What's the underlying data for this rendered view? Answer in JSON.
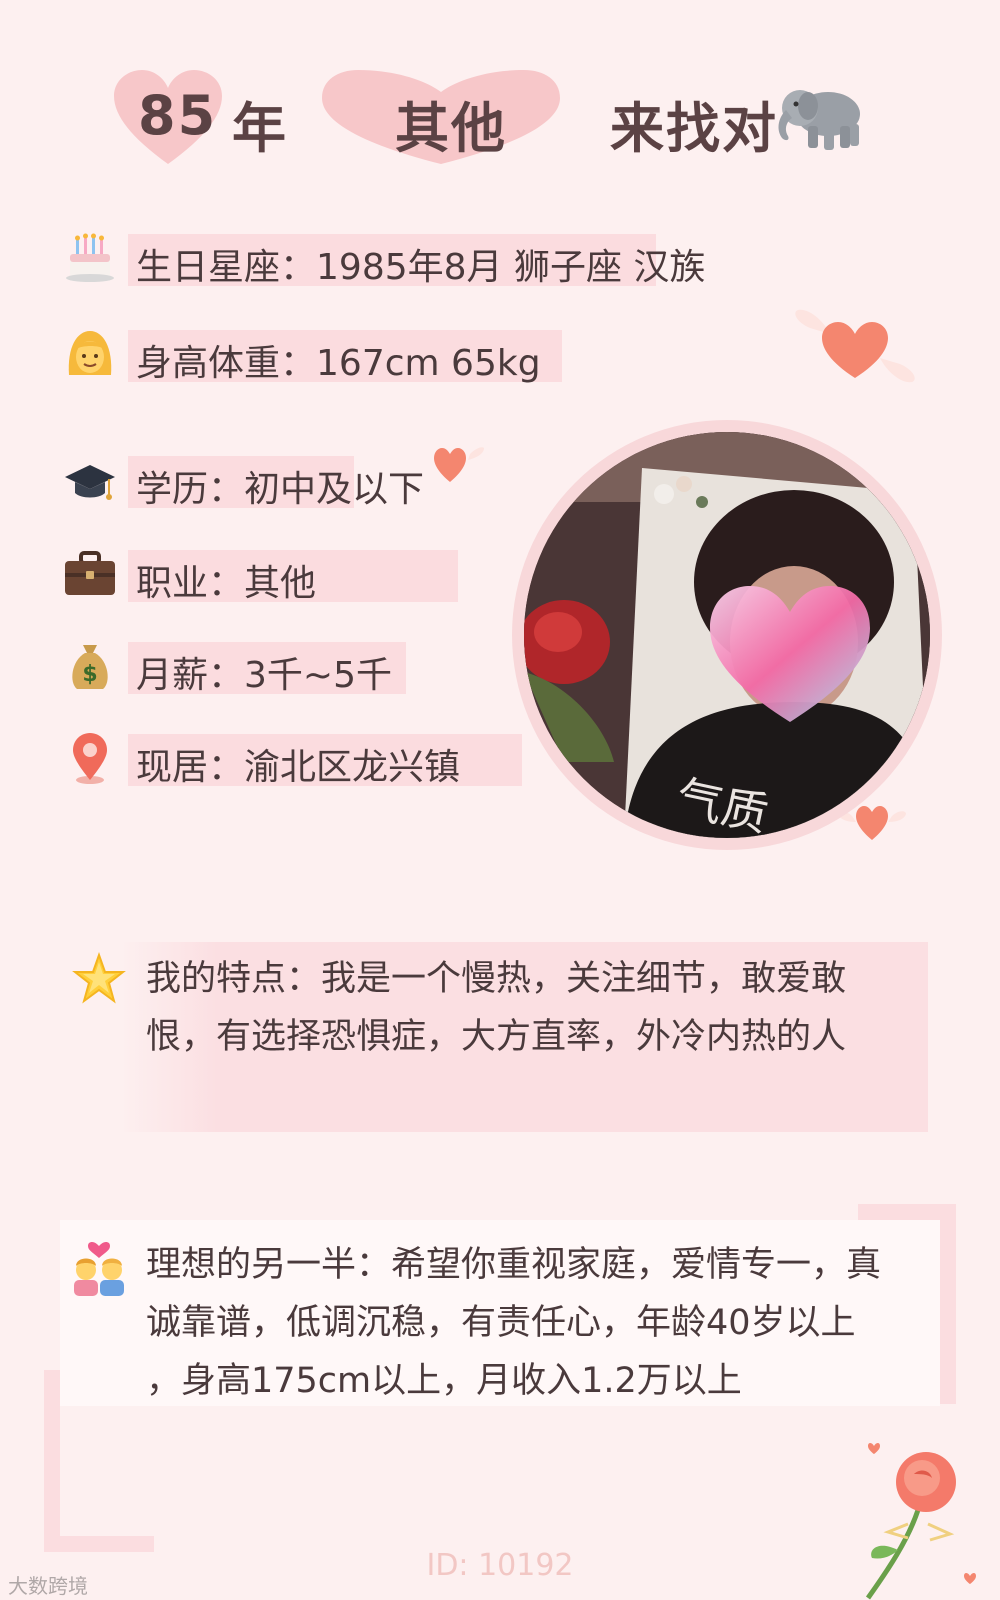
{
  "header": {
    "year": "85",
    "year_suffix": "年",
    "category": "其他",
    "tagline": "来找对",
    "tagline_icon": "elephant-icon"
  },
  "info": [
    {
      "icon": "cake-icon",
      "label": "生日星座：",
      "value": "1985年8月 狮子座 汉族"
    },
    {
      "icon": "woman-icon",
      "label": "身高体重：",
      "value": "167cm 65kg"
    },
    {
      "icon": "graduation-cap-icon",
      "label": "学历：",
      "value": "初中及以下"
    },
    {
      "icon": "briefcase-icon",
      "label": "职业：",
      "value": "其他"
    },
    {
      "icon": "money-bag-icon",
      "label": "月薪：",
      "value": "3千~5千"
    },
    {
      "icon": "location-pin-icon",
      "label": "现居：",
      "value": "渝北区龙兴镇"
    }
  ],
  "traits": {
    "icon": "star-icon",
    "label": "我的特点：",
    "line1": "我的特点：我是一个慢热，关注细节，敢爱敢",
    "line2": "恨，有选择恐惧症，大方直率，外冷内热的人"
  },
  "ideal": {
    "icon": "couple-heart-icon",
    "line1": "理想的另一半：希望你重视家庭，爱情专一，真",
    "line2": "诚靠谱，低调沉稳，有责任心，年龄40岁以上",
    "line3": "，身高175cm以上，月收入1.2万以上"
  },
  "footer": {
    "id": "ID: 10192",
    "watermark": "大数跨境"
  },
  "colors": {
    "background": "#fdf0f0",
    "row_highlight": "#fbdcdf",
    "heart": "#f7c7c9",
    "accent_heart": "#f4866f"
  }
}
